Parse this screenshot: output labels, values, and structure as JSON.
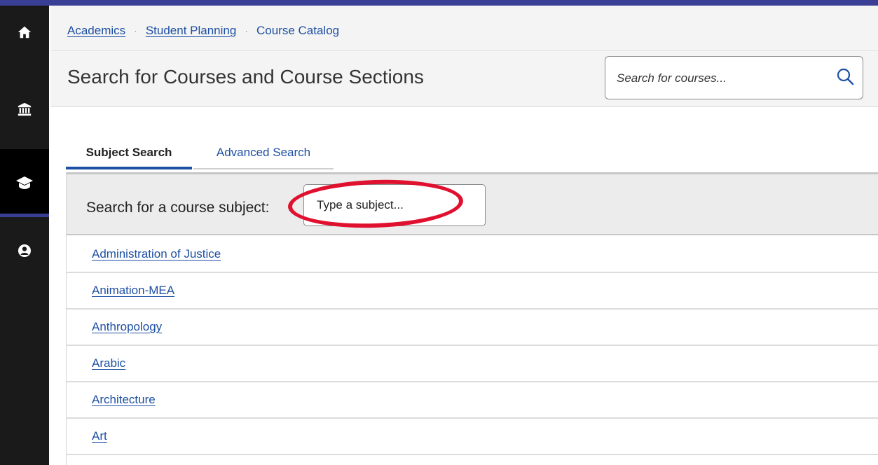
{
  "breadcrumb": {
    "items": [
      "Academics",
      "Student Planning"
    ],
    "separator": "·",
    "current": "Course Catalog"
  },
  "header": {
    "title": "Search for Courses and Course Sections",
    "search_placeholder": "Search for courses..."
  },
  "sidebar": {
    "items": [
      {
        "icon": "home-icon"
      },
      {
        "icon": "bank-icon"
      },
      {
        "icon": "graduation-cap-icon",
        "active": true
      },
      {
        "icon": "user-circle-icon"
      }
    ]
  },
  "tabs": [
    {
      "label": "Subject Search",
      "active": true
    },
    {
      "label": "Advanced Search",
      "active": false
    }
  ],
  "subject_search": {
    "label": "Search for a course subject:",
    "input_placeholder": "Type a subject..."
  },
  "subjects": [
    "Administration of Justice",
    "Animation-MEA",
    "Anthropology",
    "Arabic",
    "Architecture",
    "Art"
  ],
  "colors": {
    "brand": "#3a3f95",
    "link": "#1d4fa3",
    "annotation": "#e0102f"
  }
}
